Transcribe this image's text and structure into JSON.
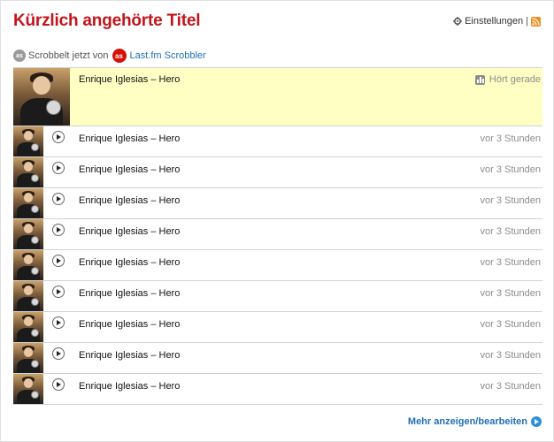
{
  "header": {
    "title": "Kürzlich angehörte Titel",
    "settings_label": "Einstellungen",
    "separator": "|"
  },
  "scrobble": {
    "prefix": "Scrobbelt jetzt von",
    "service": "Last.fm Scrobbler"
  },
  "now_playing": {
    "track": "Enrique Iglesias – Hero",
    "status": "Hört gerade"
  },
  "recent": [
    {
      "track": "Enrique Iglesias – Hero",
      "time": "vor 3 Stunden"
    },
    {
      "track": "Enrique Iglesias – Hero",
      "time": "vor 3 Stunden"
    },
    {
      "track": "Enrique Iglesias – Hero",
      "time": "vor 3 Stunden"
    },
    {
      "track": "Enrique Iglesias – Hero",
      "time": "vor 3 Stunden"
    },
    {
      "track": "Enrique Iglesias – Hero",
      "time": "vor 3 Stunden"
    },
    {
      "track": "Enrique Iglesias – Hero",
      "time": "vor 3 Stunden"
    },
    {
      "track": "Enrique Iglesias – Hero",
      "time": "vor 3 Stunden"
    },
    {
      "track": "Enrique Iglesias – Hero",
      "time": "vor 3 Stunden"
    },
    {
      "track": "Enrique Iglesias – Hero",
      "time": "vor 3 Stunden"
    }
  ],
  "footer": {
    "more_label": "Mehr anzeigen/bearbeiten"
  },
  "icons": {
    "settings": "gear-icon",
    "feed": "rss-icon",
    "scrobble": "audioscrobbler-icon",
    "play": "play-icon",
    "now_playing": "equalizer-icon",
    "more": "arrow-right-icon"
  },
  "colors": {
    "title": "#c3141b",
    "link": "#1f6fb8",
    "now_playing_bg": "#ffffc4",
    "lastfm_red": "#d51007"
  }
}
